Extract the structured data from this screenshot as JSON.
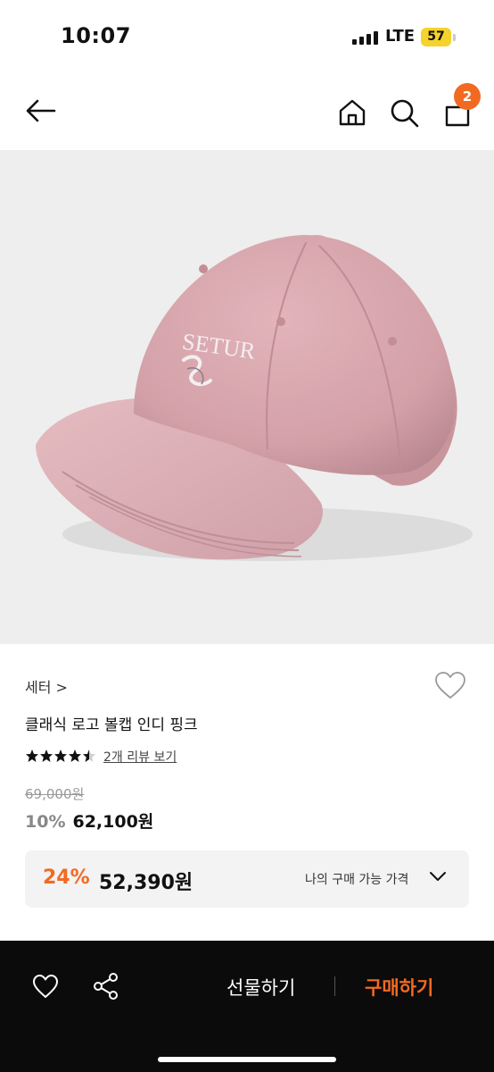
{
  "status_bar": {
    "time": "10:07",
    "network": "LTE",
    "battery": "57"
  },
  "header": {
    "cart_count": "2"
  },
  "product": {
    "brand": "세터",
    "brand_chevron": ">",
    "name": "클래식 로고 볼캡 인디 핑크",
    "rating": 4.5,
    "review_link": "2개 리뷰 보기",
    "original_price": "69,000원",
    "discount_percent": "10%",
    "sale_price": "62,100원"
  },
  "best_price": {
    "discount_percent": "24%",
    "price": "52,390원",
    "label": "나의 구매 가능 가격"
  },
  "bottom_bar": {
    "gift_label": "선물하기",
    "buy_label": "구매하기"
  },
  "colors": {
    "accent": "#f26a22",
    "cap": "#d9a9b0",
    "bottom_bar": "#0b0b0b",
    "battery": "#f5d22c"
  }
}
